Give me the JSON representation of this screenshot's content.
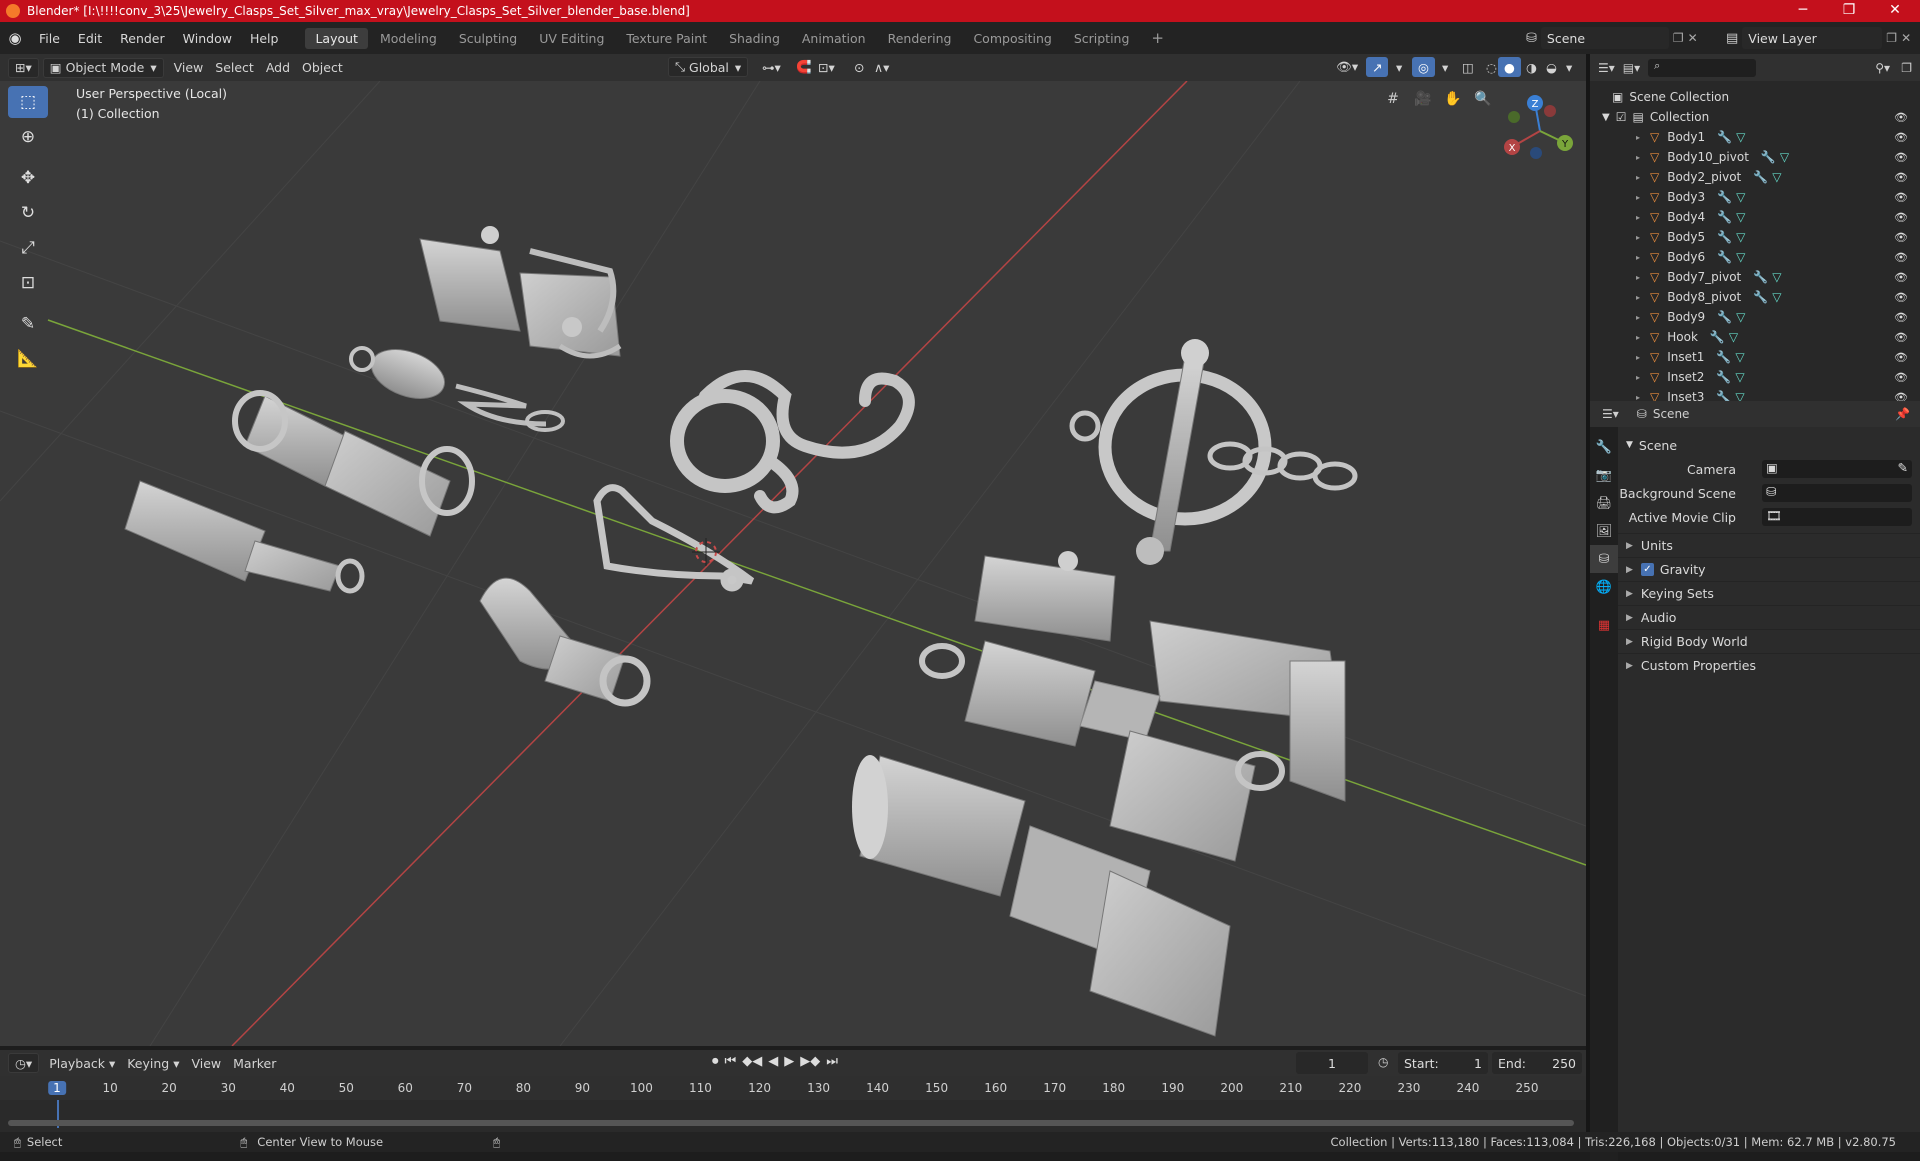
{
  "window": {
    "title": "Blender* [I:\\!!!!conv_3\\25\\Jewelry_Clasps_Set_Silver_max_vray\\Jewelry_Clasps_Set_Silver_blender_base.blend]",
    "minimize": "─",
    "maximize": "❐",
    "close": "✕"
  },
  "menubar": {
    "items": [
      "File",
      "Edit",
      "Render",
      "Window",
      "Help"
    ],
    "workspaces": [
      "Layout",
      "Modeling",
      "Sculpting",
      "UV Editing",
      "Texture Paint",
      "Shading",
      "Animation",
      "Rendering",
      "Compositing",
      "Scripting"
    ],
    "add_workspace": "+",
    "scene_label": "Scene",
    "view_layer_label": "View Layer"
  },
  "viewport_header": {
    "mode": "Object Mode",
    "menus": [
      "View",
      "Select",
      "Add",
      "Object"
    ],
    "transform_orientation": "Global"
  },
  "viewport": {
    "perspective": "User Perspective (Local)",
    "collection": "(1) Collection",
    "gizmo_axes": {
      "x": "X",
      "y": "Y",
      "z": "Z"
    }
  },
  "outliner": {
    "root": "Scene Collection",
    "collection": "Collection",
    "objects": [
      "Body1",
      "Body10_pivot",
      "Body2_pivot",
      "Body3",
      "Body4",
      "Body5",
      "Body6",
      "Body7_pivot",
      "Body8_pivot",
      "Body9",
      "Hook",
      "Inset1",
      "Inset2",
      "Inset3"
    ]
  },
  "properties": {
    "context": "Scene",
    "panel_title": "Scene",
    "camera_label": "Camera",
    "background_scene_label": "Background Scene",
    "active_movie_clip_label": "Active Movie Clip",
    "sections": [
      "Units",
      "Gravity",
      "Keying Sets",
      "Audio",
      "Rigid Body World",
      "Custom Properties"
    ],
    "gravity_enabled": true
  },
  "timeline": {
    "menus": [
      "Playback",
      "Keying",
      "View",
      "Marker"
    ],
    "current_frame": "1",
    "start_label": "Start:",
    "start": "1",
    "end_label": "End:",
    "end": "250",
    "ruler": [
      "1",
      "10",
      "20",
      "30",
      "40",
      "50",
      "60",
      "70",
      "80",
      "90",
      "100",
      "110",
      "120",
      "130",
      "140",
      "150",
      "160",
      "170",
      "180",
      "190",
      "200",
      "210",
      "220",
      "230",
      "240",
      "250"
    ]
  },
  "statusbar": {
    "left_action": "Select",
    "middle_action": "Center View to Mouse",
    "stats": "Collection | Verts:113,180 | Faces:113,084 | Tris:226,168 | Objects:0/31 | Mem: 62.7 MB | v2.80.75"
  },
  "colors": {
    "title_bar": "#c4101c",
    "accent": "#4772b3",
    "x_axis": "#b34444",
    "y_axis": "#7aa53a",
    "z_axis": "#3a7fd4"
  }
}
